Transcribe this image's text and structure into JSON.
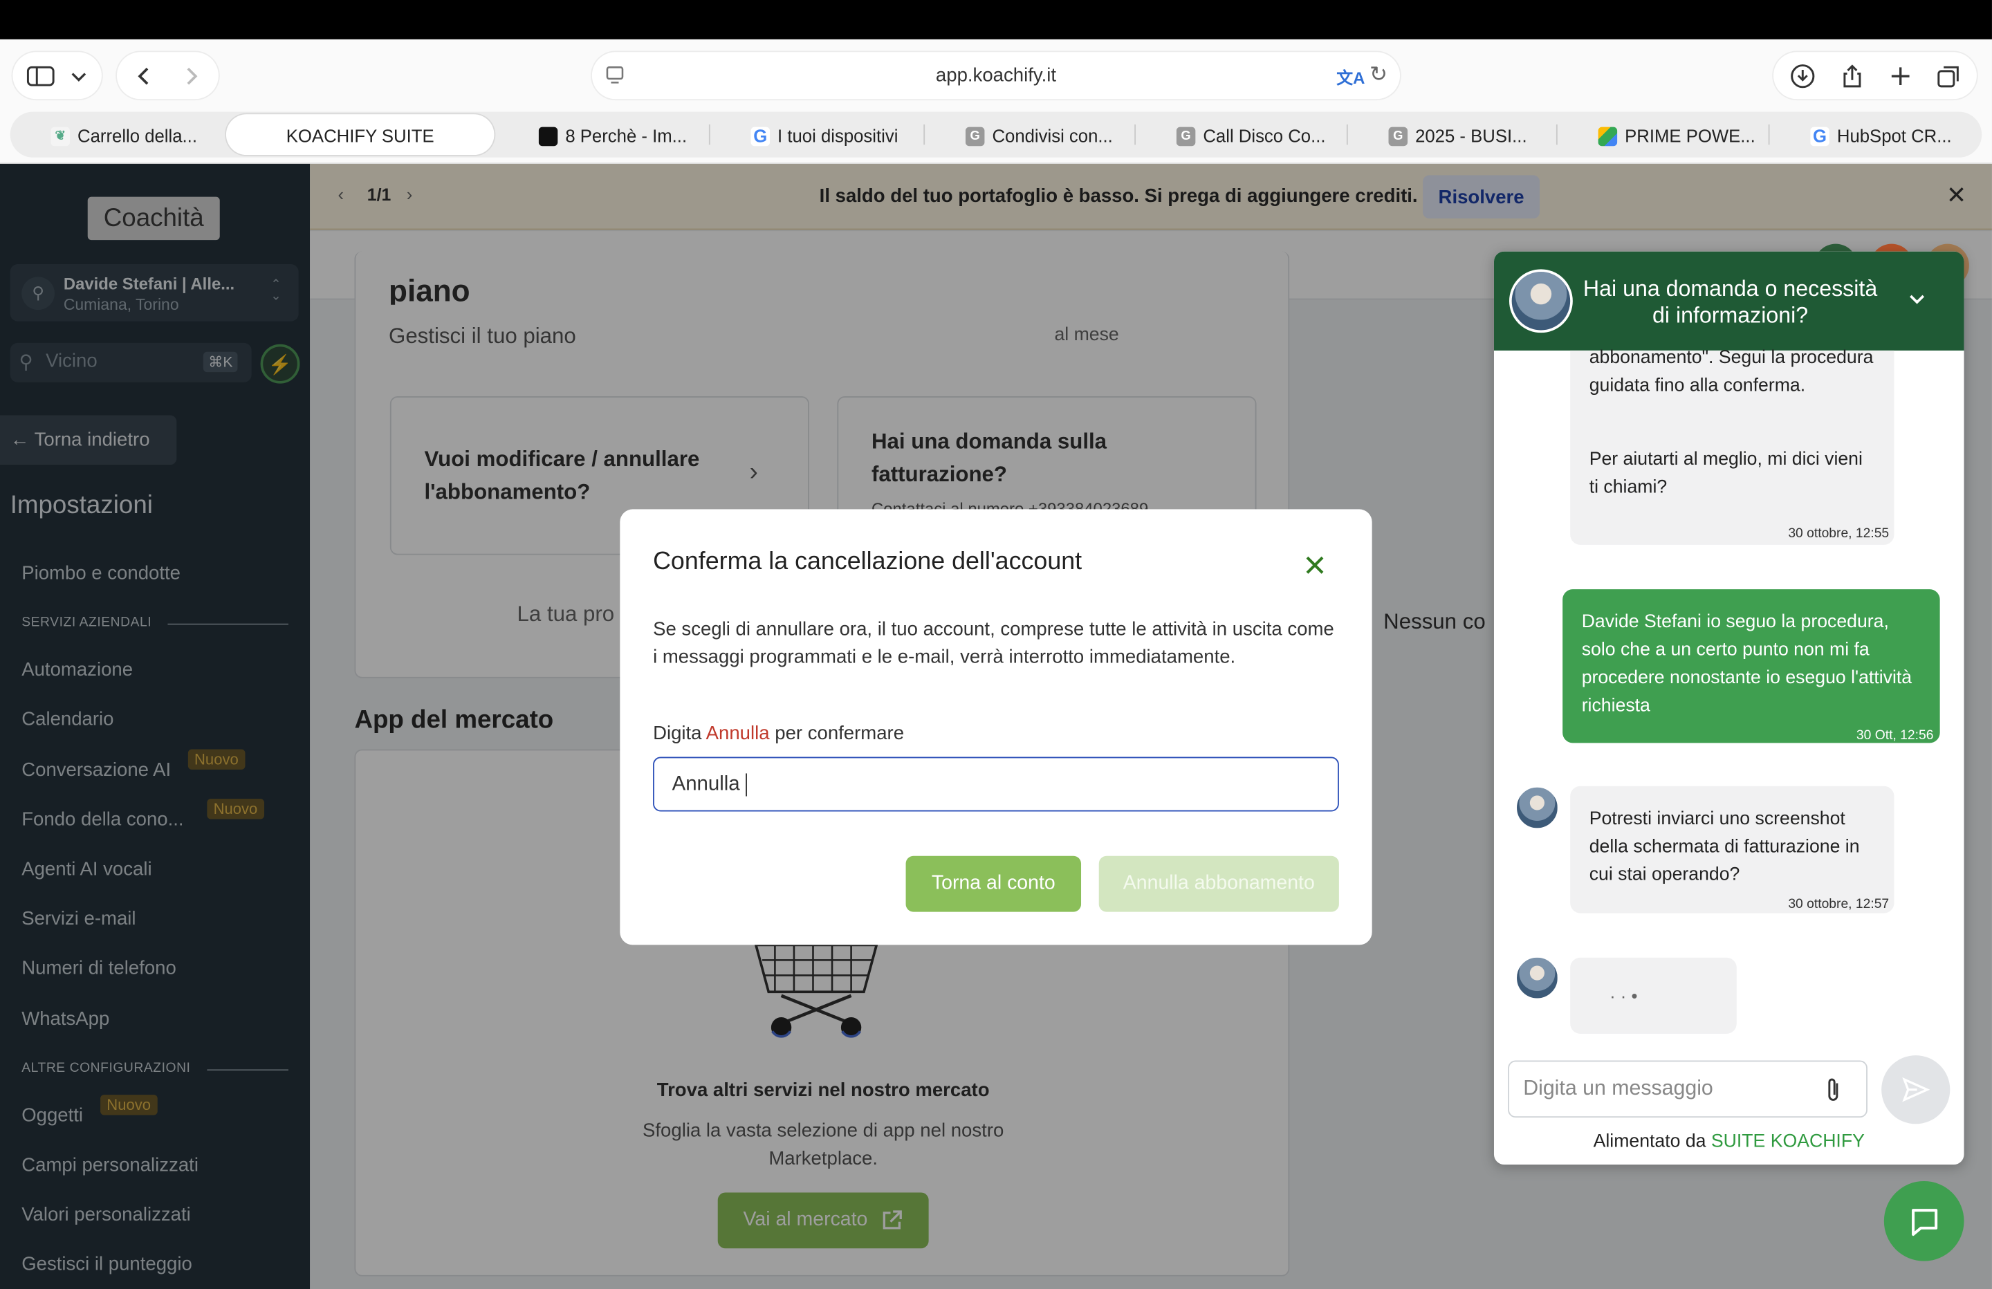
{
  "browser": {
    "url": "app.koachify.it",
    "tabs": [
      {
        "label": "Carrello della...",
        "favicon": "leaf-favicon"
      },
      {
        "label": "KOACHIFY SUITE",
        "favicon": "none"
      },
      {
        "label": "8 Perchè - Im...",
        "favicon": "dark-favicon"
      },
      {
        "label": "I tuoi dispositivi",
        "favicon": "google-favicon"
      },
      {
        "label": "Condivisi con...",
        "favicon": "g-favicon"
      },
      {
        "label": "Call Disco Co...",
        "favicon": "g-favicon"
      },
      {
        "label": "2025 - BUSI...",
        "favicon": "g-favicon"
      },
      {
        "label": "PRIME POWE...",
        "favicon": "drive-favicon"
      },
      {
        "label": "HubSpot CR...",
        "favicon": "google-favicon"
      }
    ]
  },
  "sidebar": {
    "logo": "Coachità",
    "account_name": "Davide Stefani | Alle...",
    "account_location": "Cumiana, Torino",
    "search_placeholder": "Vicino",
    "search_shortcut": "⌘K",
    "back_label": "Torna indietro",
    "heading": "Impostazioni",
    "item_piombo": "Piombo e condotte",
    "section_business": "SERVIZI AZIENDALI",
    "item_automazione": "Automazione",
    "item_calendario": "Calendario",
    "item_conversazione": "Conversazione AI",
    "item_fondo": "Fondo della cono...",
    "item_agenti": "Agenti AI vocali",
    "item_email": "Servizi e-mail",
    "item_numeri": "Numeri di telefono",
    "item_whatsapp": "WhatsApp",
    "section_other": "ALTRE CONFIGURAZIONI",
    "item_oggetti": "Oggetti",
    "item_campi": "Campi personalizzati",
    "item_valori": "Valori personalizzati",
    "item_punteggio": "Gestisci il punteggio",
    "badge_new": "Nuovo"
  },
  "banner": {
    "pager": "1/1",
    "message": "Il saldo del tuo portafoglio è basso. Si prega di aggiungere crediti.",
    "action": "Risolvere"
  },
  "main": {
    "plan_title": "piano",
    "plan_subtitle": "Gestisci il tuo piano",
    "price_suffix": "al mese",
    "card_modify": "Vuoi modificare / annullare l'abbonamento?",
    "card_billing": "Hai una domanda sulla fatturazione?",
    "card_billing_sub": "Contattaci al numero +393384023689",
    "partial_text": "La tua pro",
    "right_partial": "Nessun co",
    "market_heading": "App del mercato",
    "market_title": "Trova altri servizi nel nostro mercato",
    "market_desc": "Sfoglia la vasta selezione di app nel nostro Marketplace.",
    "market_button": "Vai al mercato"
  },
  "modal": {
    "title": "Conferma la cancellazione dell'account",
    "body": "Se scegli di annullare ora, il tuo account, comprese tutte le attività in uscita come i messaggi programmati e le e-mail, verrà interrotto immediatamente.",
    "prompt_before": "Digita",
    "prompt_keyword": "Annulla",
    "prompt_after": "per confermare",
    "input_value": "Annulla",
    "back_button": "Torna al conto",
    "cancel_button": "Annulla abbonamento"
  },
  "chat": {
    "header": "Hai una domanda o necessità di informazioni?",
    "msg1_top": "abbonamento\". Segui la procedura guidata fino alla conferma.",
    "msg1_bottom": "Per aiutarti al meglio, mi dici vieni ti chiami?",
    "msg1_time": "30 ottobre, 12:55",
    "msg2": "Davide Stefani io seguo la procedura, solo che a un certo punto non mi fa procedere nonostante io eseguo l'attività richiesta",
    "msg2_time": "30 Ott, 12:56",
    "msg3": "Potresti inviarci uno screenshot della schermata di fatturazione in cui stai operando?",
    "msg3_time": "30 ottobre, 12:57",
    "typing": "· · •",
    "input_placeholder": "Digita un messaggio",
    "powered_by": "Alimentato da",
    "powered_brand": "SUITE KOACHIFY"
  },
  "colors": {
    "sidebar_bg": "#26333d",
    "banner_bg": "#fdf5e3",
    "primary_green": "#8bbf5a",
    "chat_header": "#1f5a35",
    "user_bubble": "#3f9f50",
    "keyword_red": "#c0392b"
  }
}
